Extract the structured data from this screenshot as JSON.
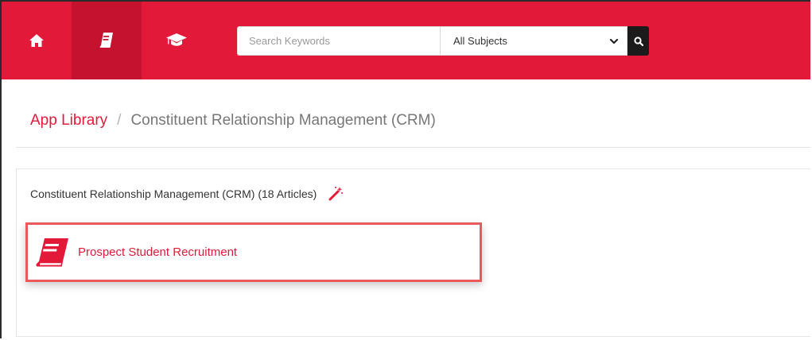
{
  "nav": {
    "items": [
      {
        "name": "home",
        "icon": "home-icon",
        "active": false
      },
      {
        "name": "book",
        "icon": "book-icon",
        "active": true
      },
      {
        "name": "graduation",
        "icon": "graduation-cap-icon",
        "active": false
      }
    ]
  },
  "search": {
    "placeholder": "Search Keywords",
    "value": "",
    "subject_selected": "All Subjects",
    "button_icon": "search-icon"
  },
  "breadcrumb": {
    "link": "App Library",
    "separator": "/",
    "current": "Constituent Relationship Management (CRM)"
  },
  "panel": {
    "heading": "Constituent Relationship Management (CRM) (18 Articles)",
    "heading_icon": "magic-wand-icon",
    "articles": [
      {
        "title": "Prospect Student Recruitment",
        "icon": "book-icon"
      }
    ]
  },
  "colors": {
    "brand_red": "#e3193a",
    "active_nav": "#c4122f",
    "highlight_border": "#ea5a5a"
  }
}
